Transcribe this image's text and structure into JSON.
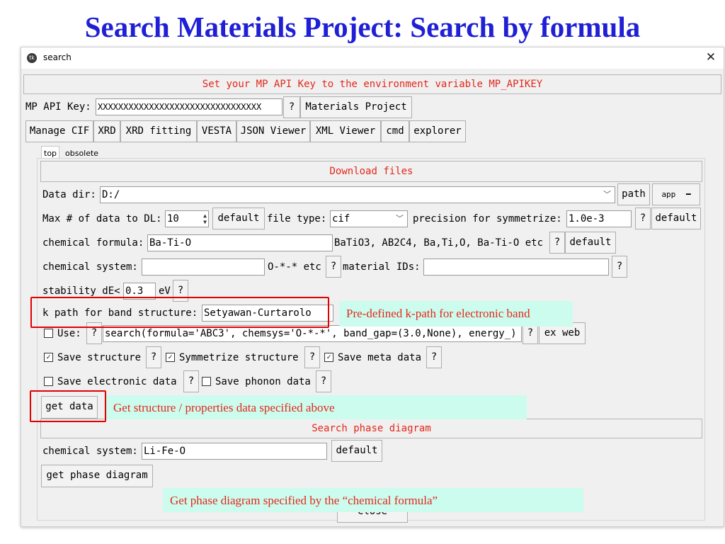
{
  "slide_title": "Search Materials Project: Search by formula",
  "window": {
    "title": "search",
    "close_label": "✕"
  },
  "header_banner": "Set your MP API Key to the environment variable MP_APIKEY",
  "api_row": {
    "label": "MP API Key:",
    "value": "XXXXXXXXXXXXXXXXXXXXXXXXXXXXXXXX",
    "help": "?",
    "mp_button": "Materials Project"
  },
  "toolbar": [
    "Manage CIF",
    "XRD",
    "XRD fitting",
    "VESTA",
    "JSON Viewer",
    "XML Viewer",
    "cmd",
    "explorer"
  ],
  "tabs": [
    {
      "label": "top",
      "active": true
    },
    {
      "label": "obsolete",
      "active": false
    }
  ],
  "download": {
    "header": "Download files",
    "data_dir_label": "Data dir:",
    "data_dir_value": "D:/",
    "path_button": "path",
    "app_label": "app",
    "max_label": "Max # of data to DL:",
    "max_value": "10",
    "default_label": "default",
    "file_type_label": "file type:",
    "file_type_value": "cif",
    "precision_label": "precision for symmetrize:",
    "precision_value": "1.0e-3",
    "help": "?",
    "formula_label": "chemical formula:",
    "formula_value": "Ba-Ti-O",
    "formula_hint": "BaTiO3, AB2C4, Ba,Ti,O, Ba-Ti-O etc",
    "chemsys_label": "chemical system:",
    "chemsys_value": "",
    "chemsys_hint": "O-*-* etc",
    "ids_label": "material IDs:",
    "ids_value": "",
    "stability_label": "stability dE<",
    "stability_value": "0.3",
    "stability_unit": "eV",
    "kpath_label": "k path for band structure:",
    "kpath_value": "Setyawan-Curtarolo",
    "use_label": "Use:",
    "use_checked": false,
    "use_query": "search(formula='ABC3', chemsys='O-*-*', band_gap=(3.0,None), energy_)",
    "exweb_label": "ex web",
    "save_structure_label": "Save structure",
    "save_structure_checked": true,
    "symmetrize_label": "Symmetrize structure",
    "symmetrize_checked": true,
    "save_meta_label": "Save meta data",
    "save_meta_checked": true,
    "save_electronic_label": "Save electronic data",
    "save_electronic_checked": false,
    "save_phonon_label": "Save phonon data",
    "save_phonon_checked": false,
    "get_data_label": "get data"
  },
  "phase": {
    "header": "Search phase diagram",
    "chemsys_label": "chemical system:",
    "chemsys_value": "Li-Fe-O",
    "default_label": "default",
    "get_phase_label": "get phase diagram",
    "close_label": "Close"
  },
  "callouts": {
    "kpath": "Pre-defined k-path for electronic band",
    "get_data": "Get structure / properties data specified above",
    "phase": "Get phase diagram specified by the “chemical formula”"
  },
  "colors": {
    "title": "#1f1fd6",
    "accent_red": "#e2281b",
    "callout_bg": "#ccfcee",
    "highlight_box": "#e20000"
  }
}
